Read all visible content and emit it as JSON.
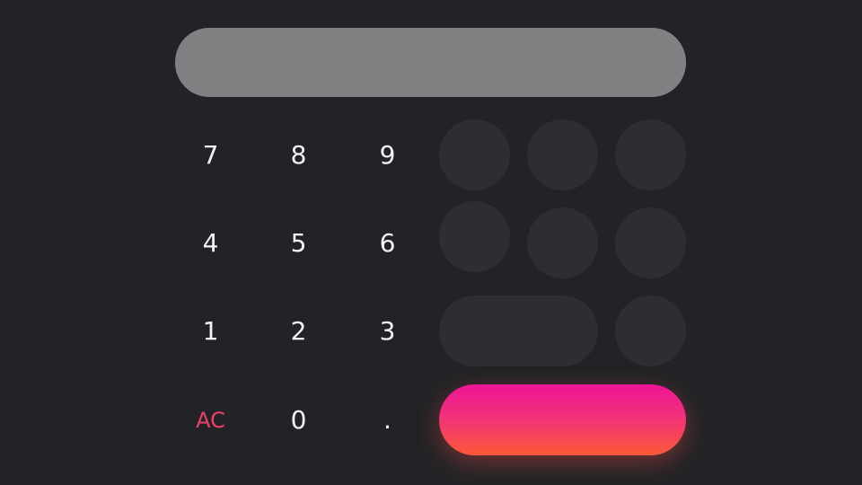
{
  "display": {
    "value": ""
  },
  "keypad": {
    "k7": "7",
    "k8": "8",
    "k9": "9",
    "k4": "4",
    "k5": "5",
    "k6": "6",
    "k1": "1",
    "k2": "2",
    "k3": "3",
    "clear": "AC",
    "k0": "0",
    "decimal": "."
  },
  "colors": {
    "background": "#222326",
    "display": "#808182",
    "key_circle": "#2d2e31",
    "clear_text": "#ee3f6a",
    "equals_gradient_top": "#ee1596",
    "equals_gradient_bottom": "#fb5a37"
  }
}
